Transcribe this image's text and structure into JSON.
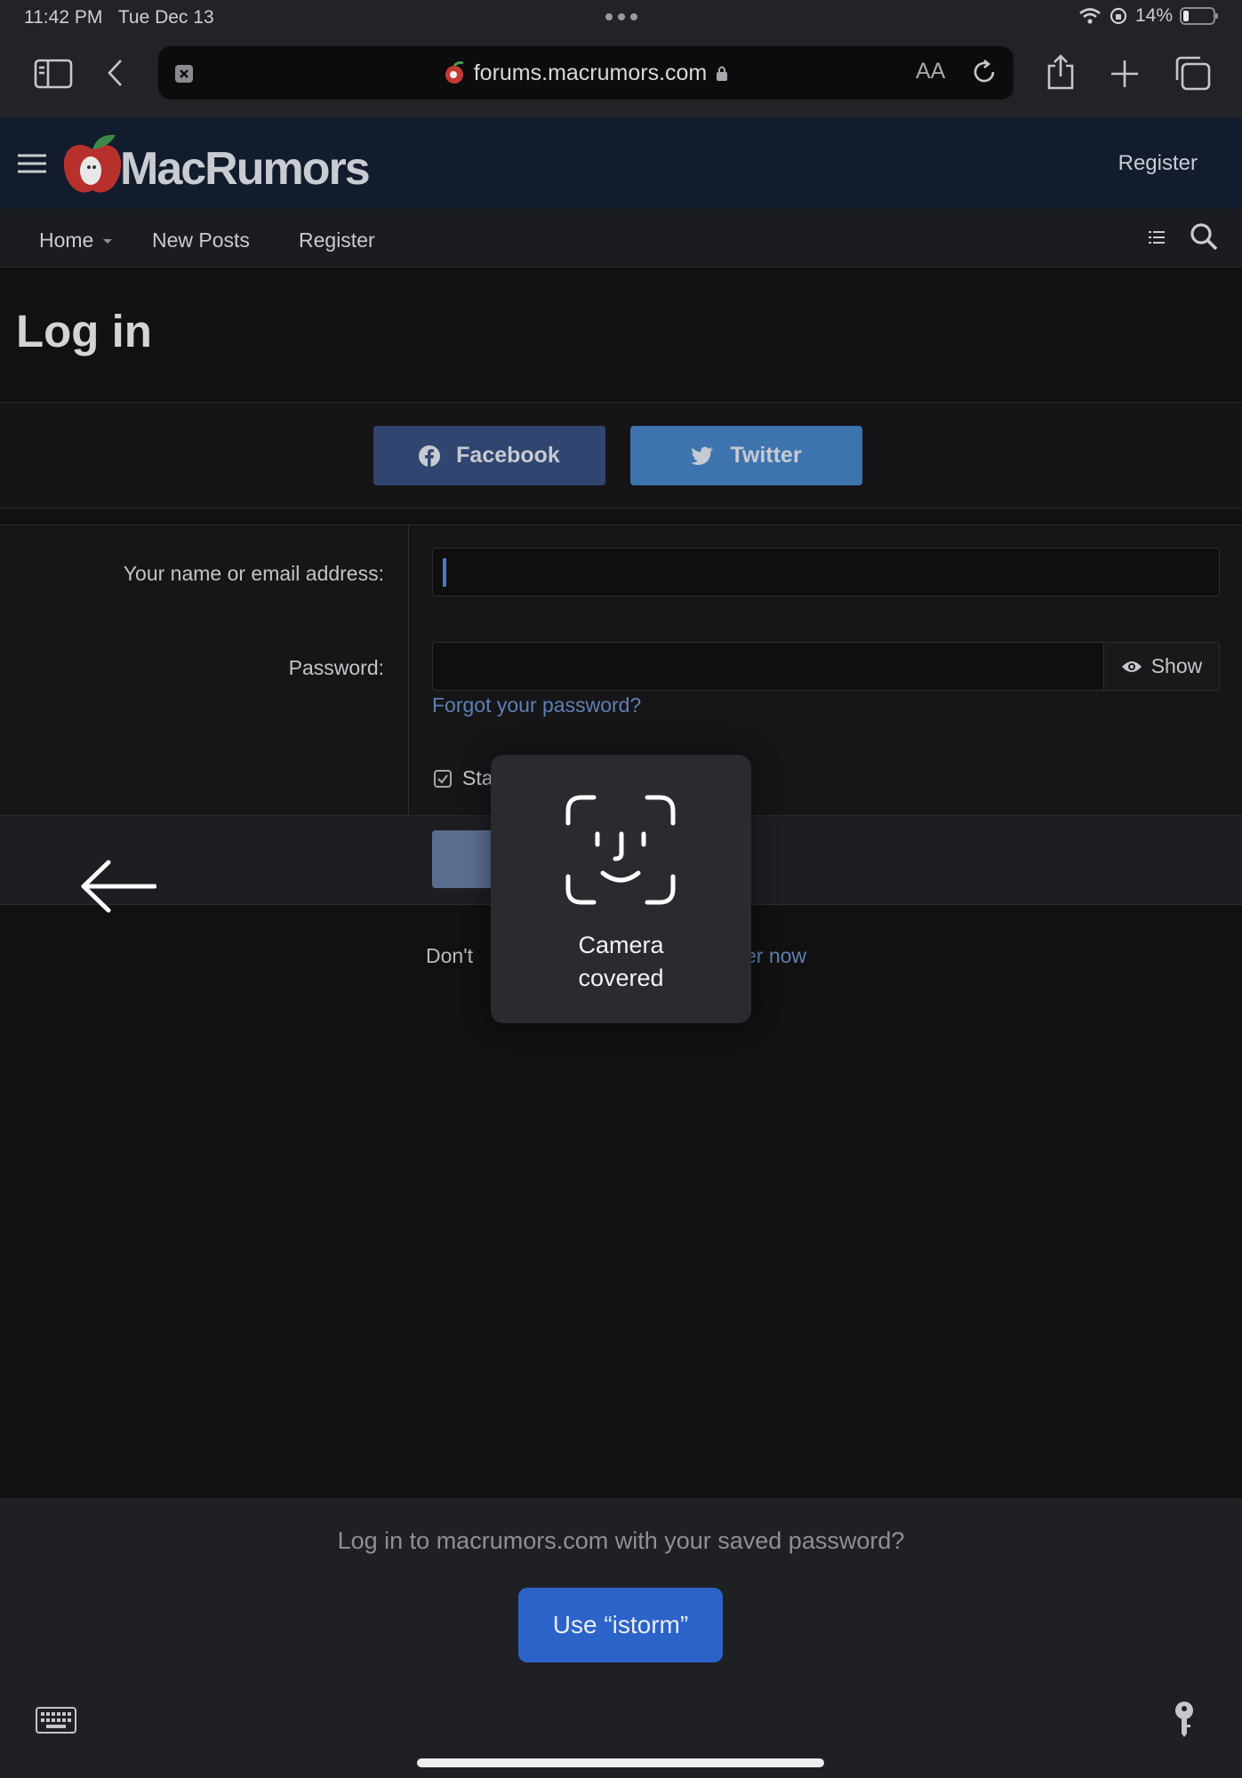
{
  "status_bar": {
    "time": "11:42 PM",
    "date": "Tue Dec 13",
    "battery": "14%"
  },
  "browser": {
    "url": "forums.macrumors.com",
    "reader_label": "AA"
  },
  "site": {
    "logo": "MacRumors",
    "header_register": "Register",
    "nav": {
      "home": "Home",
      "new_posts": "New Posts",
      "register": "Register"
    }
  },
  "page": {
    "title": "Log in",
    "facebook": "Facebook",
    "twitter": "Twitter",
    "email_label": "Your name or email address:",
    "password_label": "Password:",
    "show": "Show",
    "forgot": "Forgot your password?",
    "stay_logged_in": "Stay logged in",
    "register_prefix": "Don't",
    "register_suffix": "er now"
  },
  "overlay": {
    "line1": "Camera",
    "line2": "covered"
  },
  "autofill": {
    "prompt": "Log in to macrumors.com with your saved password?",
    "use_button": "Use “istorm”"
  }
}
